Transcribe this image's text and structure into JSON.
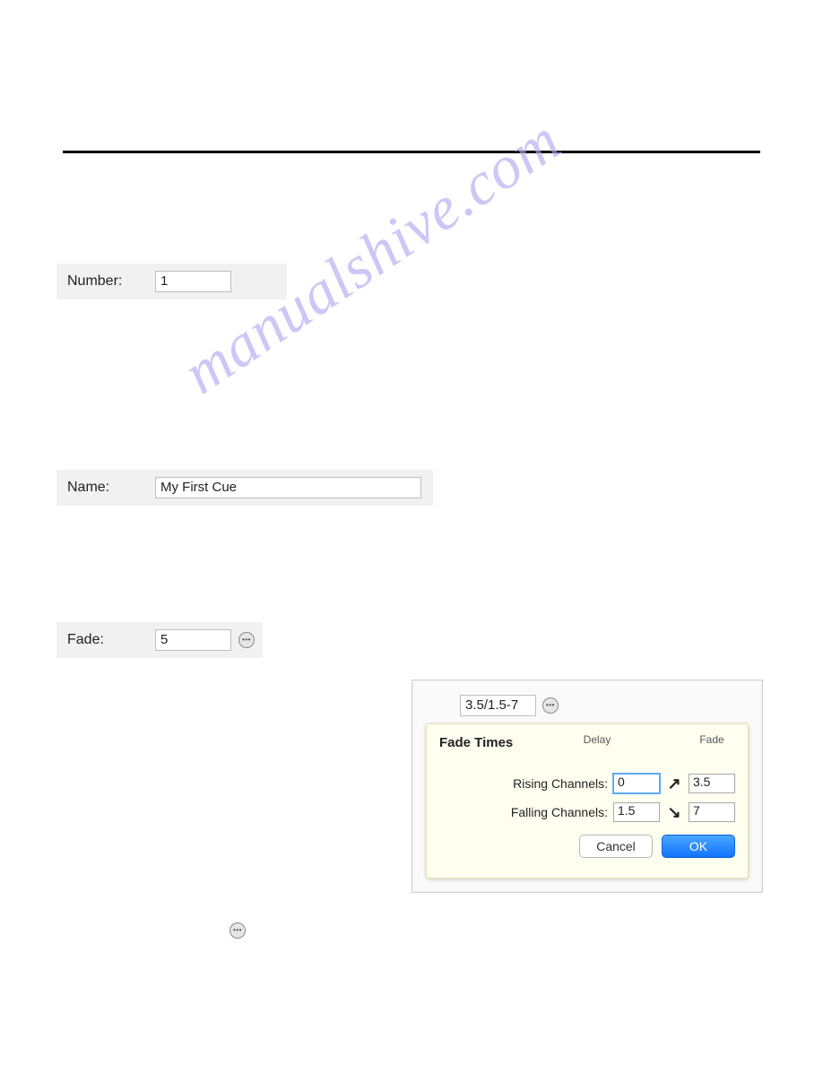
{
  "watermark": "manualshive.com",
  "fields": {
    "number": {
      "label": "Number:",
      "value": "1"
    },
    "name": {
      "label": "Name:",
      "value": "My First Cue"
    },
    "fade": {
      "label": "Fade:",
      "value": "5"
    }
  },
  "popup": {
    "summary_value": "3.5/1.5-7",
    "title": "Fade Times",
    "headers": {
      "delay": "Delay",
      "fade": "Fade"
    },
    "rows": {
      "rising": {
        "label": "Rising Channels:",
        "delay": "0",
        "fade": "3.5",
        "arrow": "↗"
      },
      "falling": {
        "label": "Falling Channels:",
        "delay": "1.5",
        "fade": "7",
        "arrow": "↘"
      }
    },
    "buttons": {
      "cancel": "Cancel",
      "ok": "OK"
    }
  }
}
